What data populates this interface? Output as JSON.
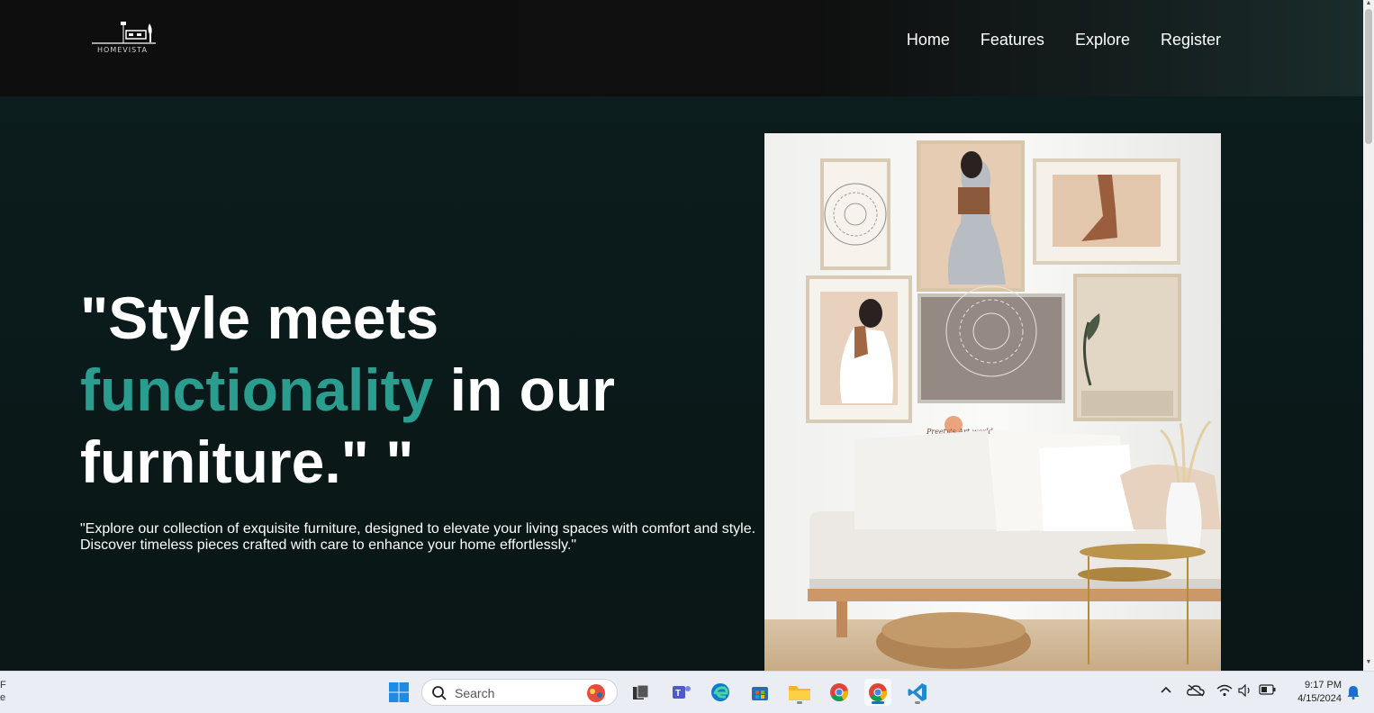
{
  "site": {
    "logo_text": "HOMEVISTA",
    "nav": [
      "Home",
      "Features",
      "Explore",
      "Register"
    ]
  },
  "hero": {
    "headline_part1": "\"Style meets",
    "headline_accent": "functionality",
    "headline_part2": " in our furniture.\" \"",
    "subtext_line1": "\"Explore our collection of exquisite furniture, designed to elevate your living spaces with comfort and style.",
    "subtext_line2": "Discover timeless pieces crafted with care to enhance your home effortlessly.\"",
    "image_caption": "Preety's Art world"
  },
  "colors": {
    "accent": "#2a9d8f",
    "background": "#0a1919",
    "navbar": "#0e0e0e"
  },
  "taskbar": {
    "weather_line1": "F",
    "weather_line2": "e",
    "search_placeholder": "Search",
    "apps": [
      "start-icon",
      "file-explorer-icon",
      "task-view-icon",
      "teams-icon",
      "edge-icon",
      "store-icon",
      "folder-icon",
      "chrome-icon",
      "chrome-active-icon",
      "vscode-icon"
    ],
    "time": "9:17 PM",
    "date": "4/15/2024"
  }
}
